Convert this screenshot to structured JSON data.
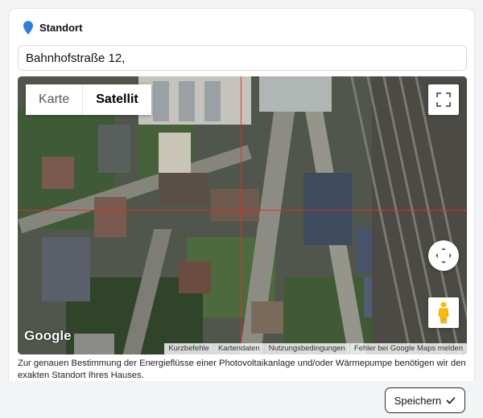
{
  "section": {
    "title": "Standort",
    "icon": "location-pin-icon",
    "accent": "#2f7de1"
  },
  "address": {
    "value": "Bahnhofstraße 12, ",
    "placeholder": ""
  },
  "map": {
    "type_options": [
      "Karte",
      "Satellit"
    ],
    "active_type": "Satellit",
    "logo": "Google",
    "attribution": [
      "Kurzbefehle",
      "Kartendaten",
      "Nutzungsbedingungen",
      "Fehler bei Google Maps melden"
    ],
    "crosshair_color": "#eb2828"
  },
  "help_text": "Zur genauen Bestimmung der Energieflüsse einer Photovoltaikanlage und/oder Wärmepumpe benötigen wir den exakten Standort Ihres Hauses.",
  "actions": {
    "save_label": "Speichern"
  }
}
